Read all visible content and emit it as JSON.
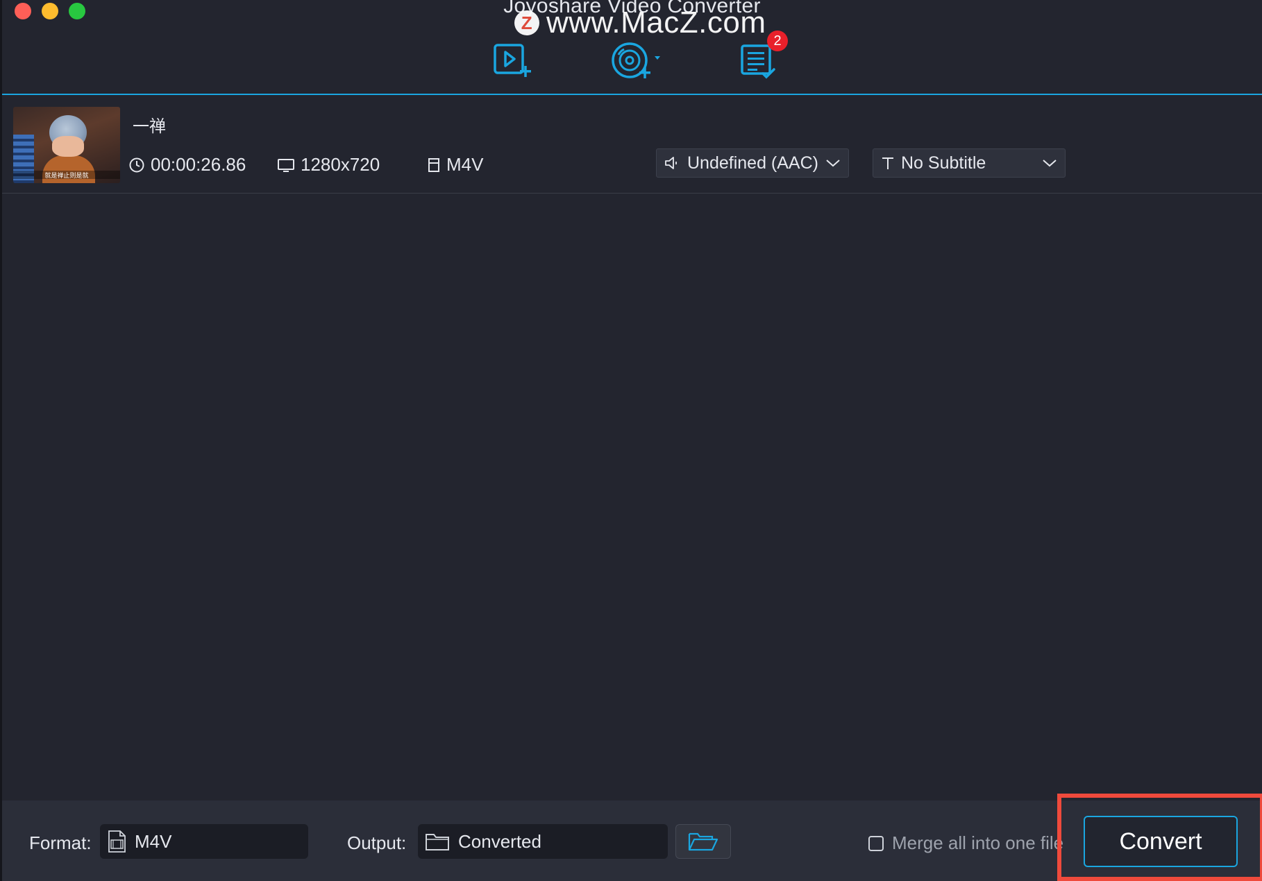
{
  "app": {
    "title": "Joyoshare Video Converter",
    "watermark": "www.MacZ.com",
    "watermark_logo": "Z"
  },
  "toolbar": {
    "add_video_icon": "add-video-icon",
    "add_dvd_icon": "add-dvd-icon",
    "history_icon": "history-list-icon",
    "history_badge": "2",
    "accent_color": "#1aa6e0",
    "badge_color": "#e8202a"
  },
  "file": {
    "name": "一禅",
    "thumbnail_caption": "就是禅止则是就",
    "duration": "00:00:26.86",
    "resolution": "1280x720",
    "format": "M4V",
    "audio_track": "Undefined (AAC)",
    "subtitle": "No Subtitle"
  },
  "bottom": {
    "format_label": "Format:",
    "format_value": "M4V",
    "output_label": "Output:",
    "output_value": "Converted",
    "merge_label": "Merge all into one file",
    "merge_checked": false,
    "convert_label": "Convert",
    "highlight_color": "#ef4a3c"
  }
}
